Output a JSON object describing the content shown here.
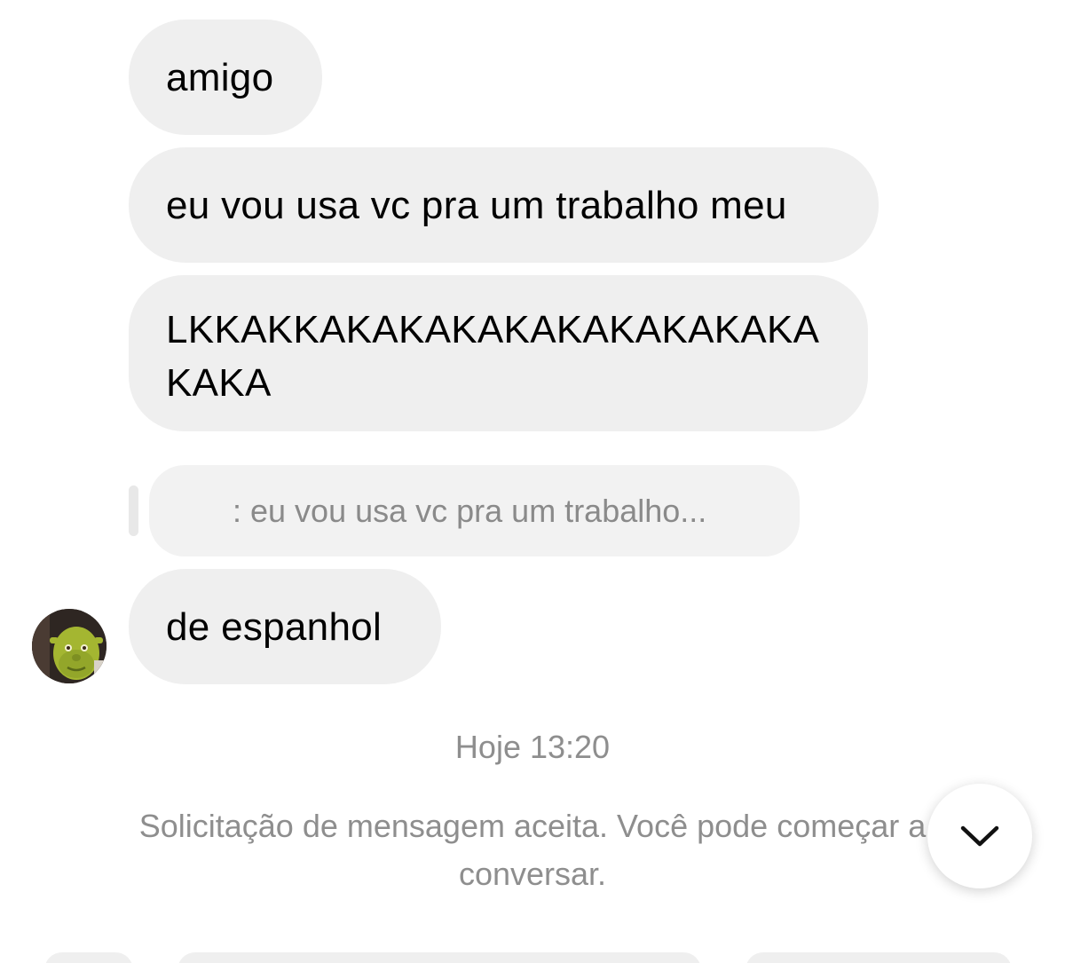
{
  "messages": [
    {
      "text": "amigo"
    },
    {
      "text": "eu vou usa vc pra um trabalho meu"
    },
    {
      "text": "LKKAKKAKAKAKAKAKAKAKAKAKAKAKA"
    },
    {
      "text": "de espanhol"
    }
  ],
  "reply_preview": {
    "text": ": eu vou usa vc pra um trabalho..."
  },
  "sender": {
    "avatar_icon": "avatar-photo"
  },
  "timestamp": "Hoje 13:20",
  "system_message": "Solicitação de mensagem aceita. Você pode começar a conversar.",
  "scroll_down_icon": "chevron-down-icon",
  "colors": {
    "bubble_bg": "#efefef",
    "secondary_text": "#8e8e8e",
    "primary_text": "#000000"
  }
}
